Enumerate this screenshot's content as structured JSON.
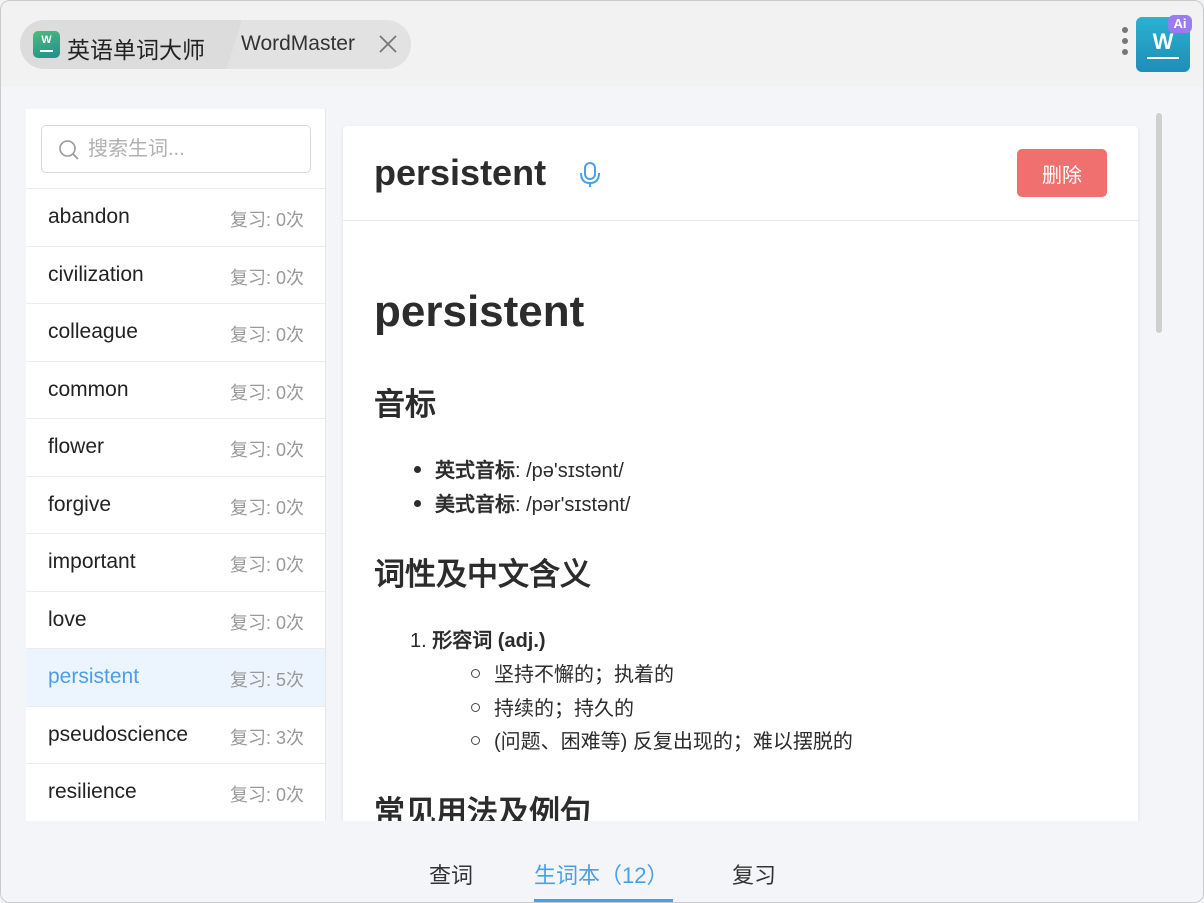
{
  "titlebar": {
    "app_name": "英语单词大师",
    "app_icon_letter": "W",
    "tab_title": "WordMaster",
    "ai_logo_letter": "W",
    "ai_badge": "Ai"
  },
  "sidebar": {
    "search_placeholder": "搜索生词...",
    "words": [
      {
        "word": "abandon",
        "count": "复习: 0次"
      },
      {
        "word": "civilization",
        "count": "复习: 0次"
      },
      {
        "word": "colleague",
        "count": "复习: 0次"
      },
      {
        "word": "common",
        "count": "复习: 0次"
      },
      {
        "word": "flower",
        "count": "复习: 0次"
      },
      {
        "word": "forgive",
        "count": "复习: 0次"
      },
      {
        "word": "important",
        "count": "复习: 0次"
      },
      {
        "word": "love",
        "count": "复习: 0次"
      },
      {
        "word": "persistent",
        "count": "复习: 5次"
      },
      {
        "word": "pseudoscience",
        "count": "复习: 3次"
      },
      {
        "word": "resilience",
        "count": "复习: 0次"
      }
    ],
    "selected_index": 8
  },
  "detail": {
    "header_word": "persistent",
    "delete_label": "删除",
    "title": "persistent",
    "phonetics_heading": "音标",
    "uk_label": "英式音标",
    "uk_value": ": /pə'sɪstənt/",
    "us_label": "美式音标",
    "us_value": ": /pər'sɪstənt/",
    "pos_heading": "词性及中文含义",
    "pos_number": "1.",
    "pos_label": "形容词 (adj.)",
    "meanings": [
      "坚持不懈的；执着的",
      "持续的；持久的",
      "(问题、困难等) 反复出现的；难以摆脱的"
    ],
    "usage_heading": "常见用法及例句"
  },
  "bottom_nav": {
    "tabs": [
      "查词",
      "生词本（12）",
      "复习"
    ],
    "active_index": 1
  },
  "colors": {
    "accent": "#4aa0e6",
    "delete": "#f07070",
    "selected_row": "#ecf4fe"
  }
}
